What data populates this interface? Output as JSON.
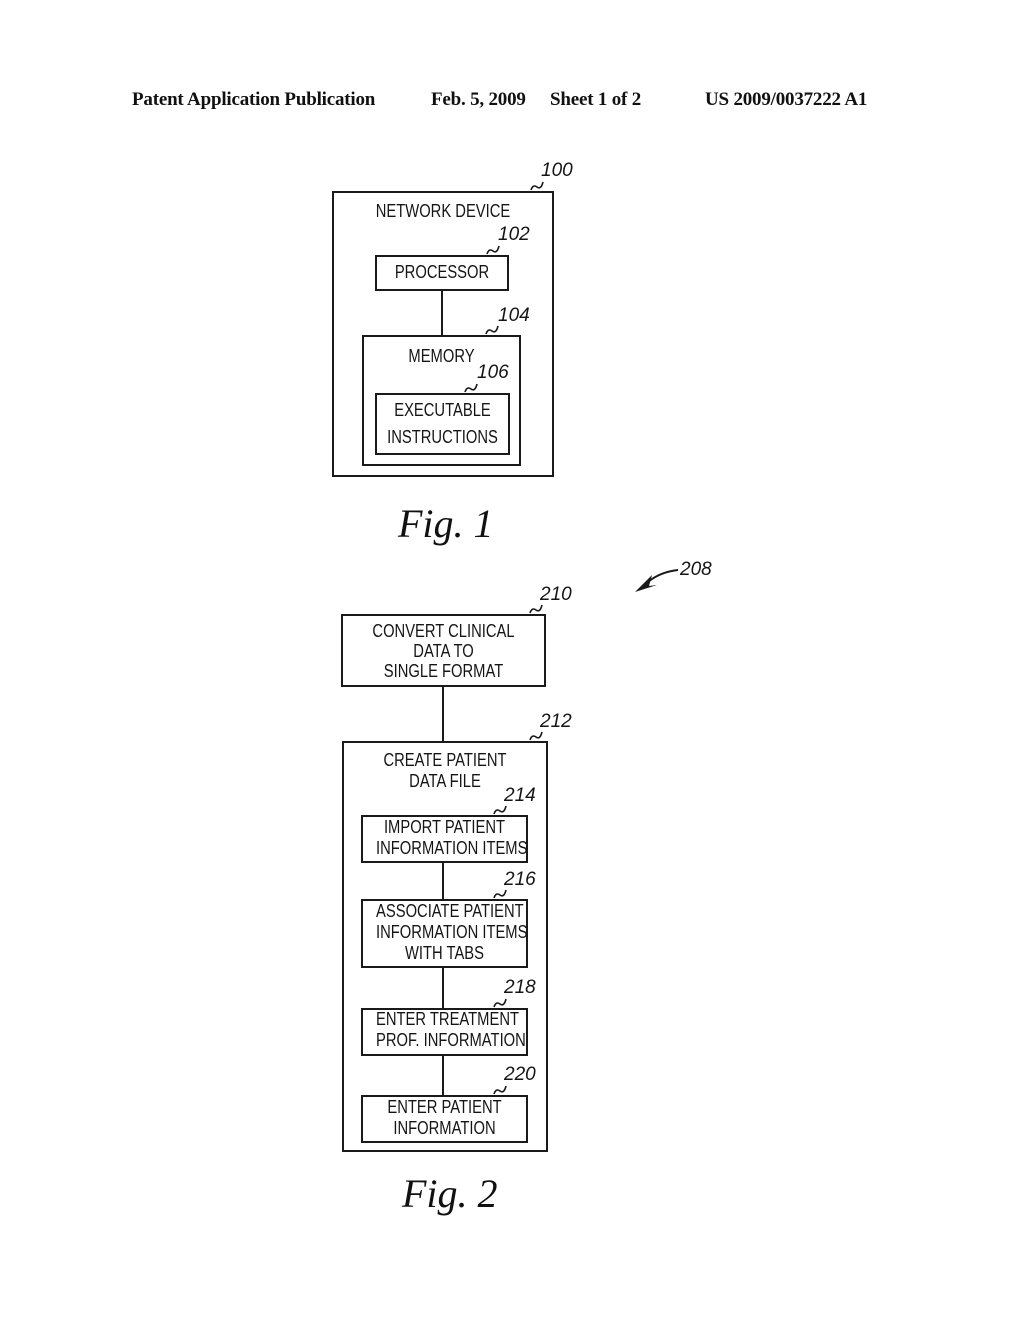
{
  "header": {
    "publication_type": "Patent Application Publication",
    "date": "Feb. 5, 2009",
    "sheet": "Sheet 1 of 2",
    "patent_number": "US 2009/0037222 A1"
  },
  "figure1": {
    "caption": "Fig. 1",
    "network_device": {
      "ref": "100",
      "label": "NETWORK DEVICE"
    },
    "processor": {
      "ref": "102",
      "label": "PROCESSOR"
    },
    "memory": {
      "ref": "104",
      "label": "MEMORY"
    },
    "instructions": {
      "ref": "106",
      "line1": "EXECUTABLE",
      "line2": "INSTRUCTIONS"
    }
  },
  "figure2": {
    "caption": "Fig. 2",
    "ref": "208",
    "steps": [
      {
        "ref": "210",
        "lines": [
          "CONVERT CLINICAL",
          "DATA TO",
          "SINGLE FORMAT"
        ]
      },
      {
        "ref": "212",
        "lines": [
          "CREATE PATIENT",
          "DATA FILE"
        ]
      },
      {
        "ref": "214",
        "lines": [
          "IMPORT PATIENT",
          "INFORMATION ITEMS"
        ]
      },
      {
        "ref": "216",
        "lines": [
          "ASSOCIATE PATIENT",
          "INFORMATION ITEMS",
          "WITH TABS"
        ]
      },
      {
        "ref": "218",
        "lines": [
          "ENTER TREATMENT",
          "PROF. INFORMATION"
        ]
      },
      {
        "ref": "220",
        "lines": [
          "ENTER PATIENT",
          "INFORMATION"
        ]
      }
    ]
  }
}
